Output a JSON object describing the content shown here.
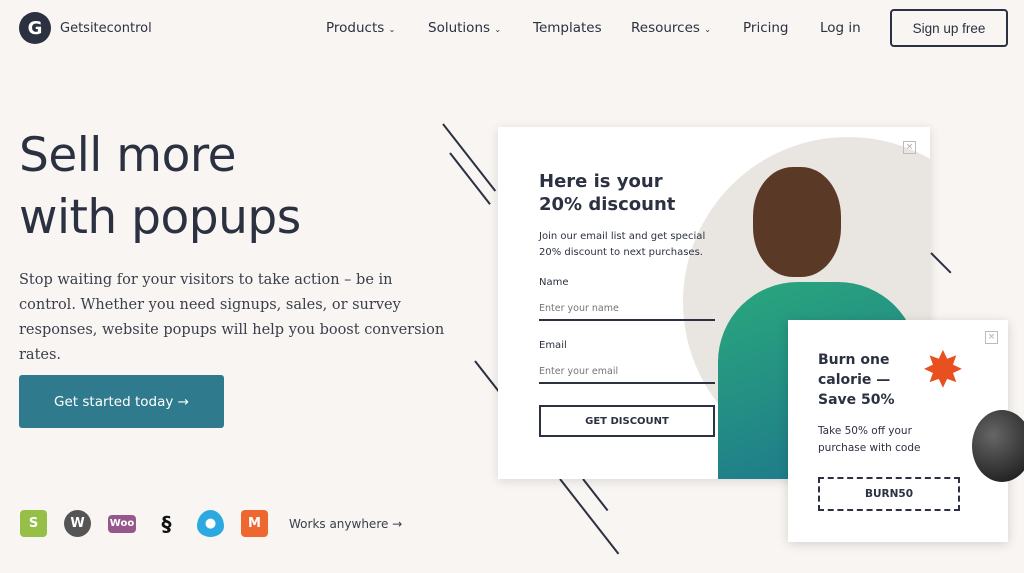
{
  "nav": {
    "logo": "Getsitecontrol",
    "items": [
      "Products",
      "Solutions",
      "Templates",
      "Resources",
      "Pricing",
      "Log in"
    ],
    "dropdown": [
      true,
      true,
      false,
      true,
      false,
      false
    ],
    "signup": "Sign up free"
  },
  "hero": {
    "title_line1": "Sell more",
    "title_line2": "with popups",
    "lead": "Stop waiting for your visitors to take action – be in control. Whether you need signups, sales, or survey responses, website popups will help you boost conversion rates.",
    "cta": "Get started today →",
    "works": "Works anywhere →",
    "brands": [
      "shopify",
      "wordpress",
      "woocommerce",
      "squarespace",
      "drupal",
      "magento"
    ]
  },
  "popup": {
    "title_line1": "Here is your",
    "title_line2": "20% discount",
    "desc": "Join our email list and get special 20% discount to next purchases.",
    "name_label": "Name",
    "name_placeholder": "Enter your name",
    "email_label": "Email",
    "email_placeholder": "Enter your email",
    "button": "GET DISCOUNT",
    "close": "×"
  },
  "popup2": {
    "title_line1": "Burn one",
    "title_line2": "calorie —",
    "title_line3": "Save 50%",
    "desc_line1": "Take 50% off your",
    "desc_line2": "purchase with code",
    "code": "BURN50",
    "close": "×"
  },
  "colors": {
    "accent": "#2f7b8d",
    "dark": "#2b3140",
    "bg": "#f8f5f2"
  }
}
